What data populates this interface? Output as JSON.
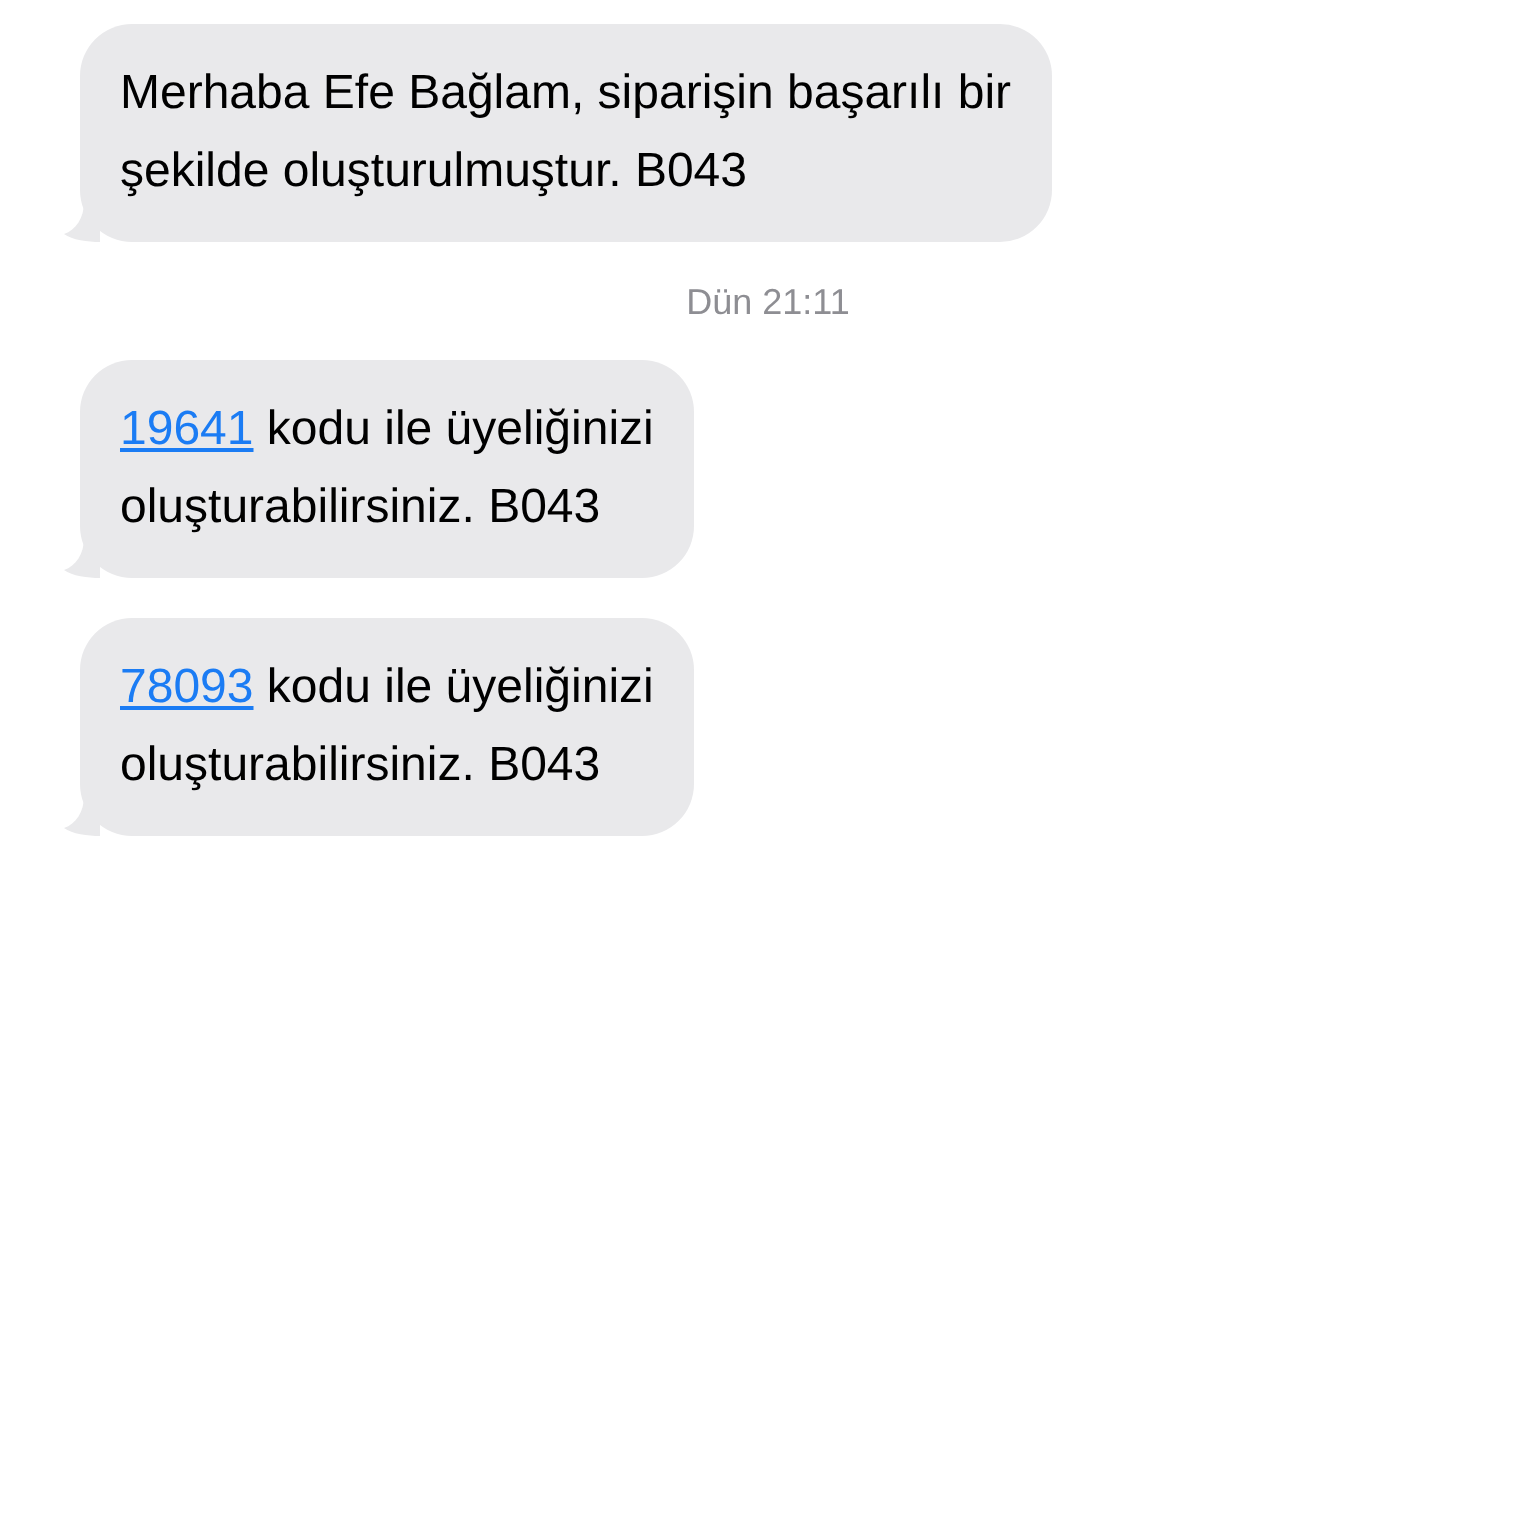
{
  "messages": [
    {
      "kind": "plain",
      "text": "Merhaba Efe Bağlam, siparişin başarılı bir\nşekilde oluşturulmuştur. B043"
    },
    {
      "kind": "timestamp",
      "text": "Dün 21:11"
    },
    {
      "kind": "code",
      "code": "19641",
      "text": " kodu ile üyeliğinizi\noluşturabilirsiniz. B043"
    },
    {
      "kind": "code",
      "code": "78093",
      "text": " kodu ile üyeliğinizi\noluşturabilirsiniz. B043"
    }
  ]
}
